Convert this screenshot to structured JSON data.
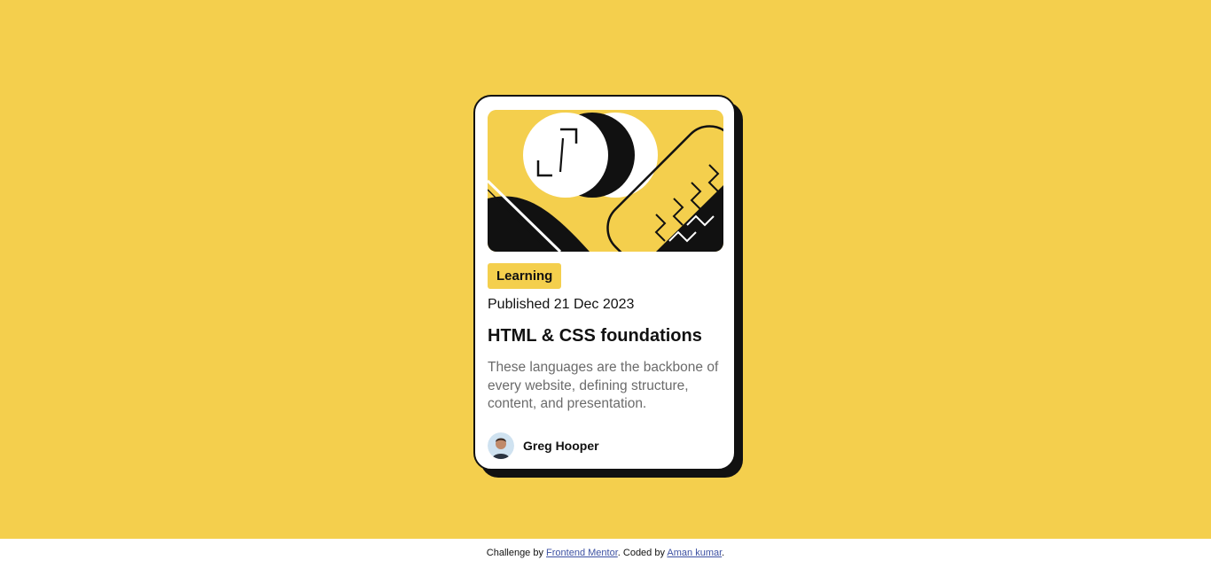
{
  "card": {
    "tag": "Learning",
    "published": "Published 21 Dec 2023",
    "title": "HTML & CSS foundations",
    "description": "These languages are the backbone of every website, defining structure, content, and presentation.",
    "author": "Greg Hooper",
    "hero_icon": "illustration-article",
    "avatar_icon": "author-avatar"
  },
  "footer": {
    "prefix": "Challenge by ",
    "link1": "Frontend Mentor",
    "middle": ". Coded by ",
    "link2": "Aman kumar",
    "suffix": "."
  },
  "colors": {
    "background": "#f4cf4d",
    "text": "#111111",
    "muted": "#6b6b6b",
    "link": "#3e52a3"
  }
}
